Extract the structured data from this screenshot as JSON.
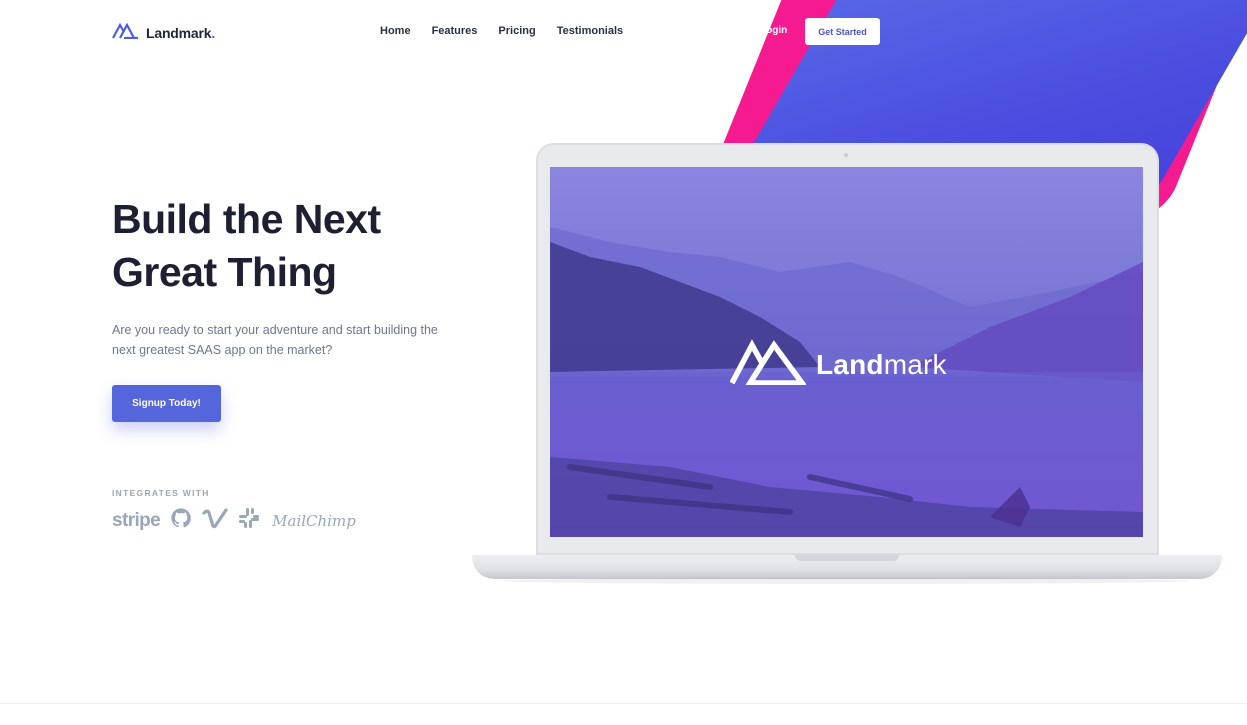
{
  "brand": {
    "name": "Landmark",
    "dot": ".",
    "icon": "landmark-mountain-icon",
    "accent": "#5467e2"
  },
  "nav": {
    "items": [
      "Home",
      "Features",
      "Pricing",
      "Testimonials"
    ]
  },
  "header": {
    "login": "Login",
    "get_started": "Get Started"
  },
  "hero": {
    "title_line1": "Build the Next",
    "title_line2": "Great Thing",
    "subtitle": "Are you ready to start your adventure and start building the next greatest SAAS app on the market?",
    "cta": "Signup Today!"
  },
  "integrations": {
    "label": "INTEGRATES WITH",
    "stripe": "stripe",
    "mailchimp": "MailChimp",
    "icons": [
      "stripe-logo",
      "github-icon",
      "vimeo-icon",
      "slack-icon",
      "mailchimp-logo"
    ]
  },
  "laptop": {
    "screen_brand_bold": "Land",
    "screen_brand_light": "mark"
  },
  "colors": {
    "primary": "#5565dc",
    "pink": "#f51a8f",
    "blue": "#4b4fe0",
    "muted": "#9aa6b9"
  }
}
